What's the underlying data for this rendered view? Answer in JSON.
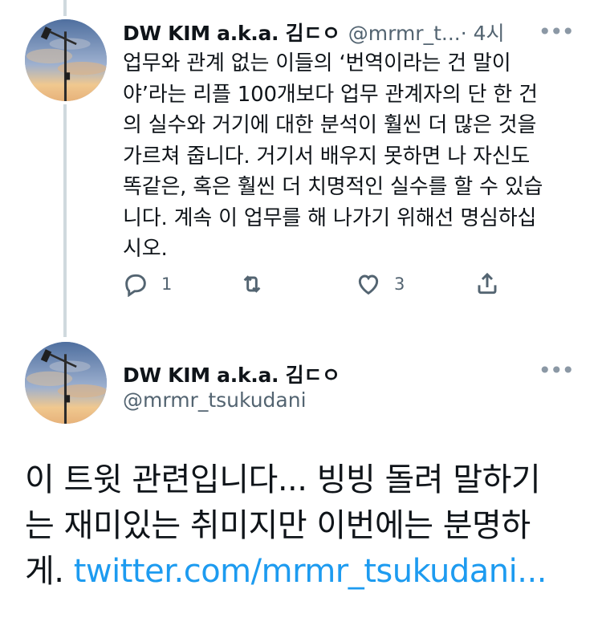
{
  "tweet1": {
    "display_name": "DW KIM a.k.a. 김ㄷㅇ",
    "handle": "@mrmr_t...",
    "time": "· 4시",
    "more_label": "•••",
    "lines": [
      "업무와 관계 없는 이들의 ‘번역이라는 건 말이",
      "야’라는 리플 100개보다 업무 관계자의 단 한 건",
      "의 실수와 거기에 대한 분석이 훨씬 더 많은 것을",
      "가르쳐 줍니다. 거기서 배우지 못하면 나 자신도",
      "똑같은, 혹은 훨씬 더 치명적인 실수를 할 수 있습",
      "니다. 계속 이 업무를 해 나가기 위해선 명심하십",
      "시오."
    ],
    "actions": {
      "reply_icon": "reply-icon",
      "reply_count": "1",
      "retweet_icon": "retweet-icon",
      "retweet_count": "",
      "like_icon": "heart-icon",
      "like_count": "3",
      "share_icon": "share-icon"
    }
  },
  "tweet2": {
    "display_name": "DW KIM a.k.a. 김ㄷㅇ",
    "handle": "@mrmr_tsukudani",
    "more_label": "•••",
    "lines": [
      "이 트윗 관련입니다... 빙빙 돌려 말하기",
      "는 재미있는 취미지만 이번에는 분명하"
    ],
    "last_line_prefix": "게. ",
    "link_text": "twitter.com/mrmr_tsukudani..."
  },
  "colors": {
    "text": "#0f1419",
    "secondary": "#536471",
    "link": "#1d9bf0",
    "thread_line": "#cfd9de"
  }
}
